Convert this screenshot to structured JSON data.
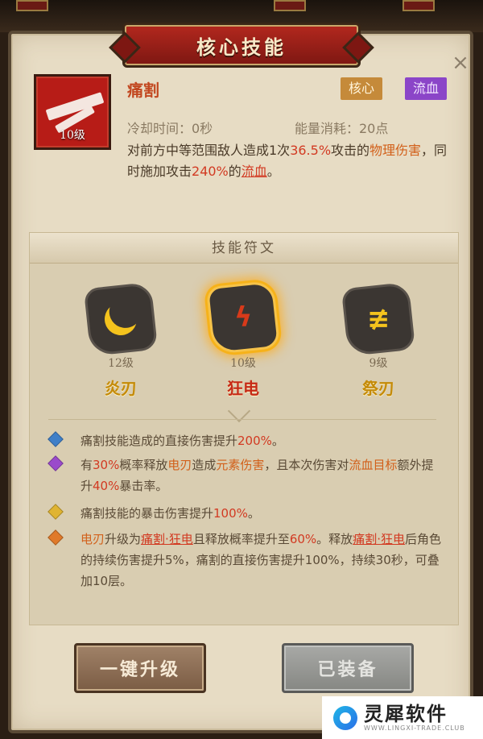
{
  "panel": {
    "title": "核心技能",
    "close_symbol": "×"
  },
  "skill": {
    "level": "10级",
    "name": "痛割",
    "tags": [
      "核心",
      "流血"
    ],
    "cooldown": "冷却时间：0秒",
    "energy": "能量消耗：20点",
    "desc_parts": {
      "p1": "对前方中等范围敌人造成1次",
      "pct": "36.5%",
      "p2": "攻击的",
      "phys": "物理伤害",
      "p3": "，同时施加攻击",
      "pct2": "240%",
      "p4": "的",
      "bleed": "流血",
      "p5": "。"
    }
  },
  "runes": {
    "header": "技能符文",
    "items": [
      {
        "level": "12级",
        "name": "炎刃",
        "icon": "crescent-icon"
      },
      {
        "level": "10级",
        "name": "狂电",
        "icon": "lightning-rune-icon",
        "selected": true
      },
      {
        "level": "9级",
        "name": "祭刃",
        "icon": "blade-rune-icon"
      }
    ]
  },
  "effects": [
    {
      "color": "#3f7fc8",
      "text": "痛割技能造成的直接伤害提升",
      "hl": "200%",
      "tail": "。"
    },
    {
      "color": "#9a4acb",
      "text_a": "有",
      "hl_a": "30%",
      "text_b": "概率释放",
      "hl_b": "电刃",
      "text_c": "造成",
      "hl_c": "元素伤害",
      "text_d": "，且本次伤害对",
      "hl_d": "流血目标",
      "text_e": "额外提升",
      "hl_e": "40%",
      "text_f": "暴击率。"
    },
    {
      "color": "#e0b432",
      "text": "痛割技能的暴击伤害提升",
      "hl": "100%",
      "tail": "。"
    },
    {
      "color": "#e07a2a",
      "text_a": "电刃",
      "text_b": "升级为",
      "hl_b": "痛割·狂电",
      "text_c": "且释放概率提升至",
      "hl_c": "60%",
      "text_d": "。释放",
      "hl_d": "痛割·狂电",
      "text_e": "后角色的持续伤害提升5%，痛割的直接伤害提升100%，持续30秒，可叠加10层。"
    }
  ],
  "buttons": {
    "upgrade": "一键升级",
    "equipped": "已装备"
  },
  "watermark": {
    "title": "灵犀软件",
    "sub": "WWW.LINGXI-TRADE.CLUB"
  }
}
